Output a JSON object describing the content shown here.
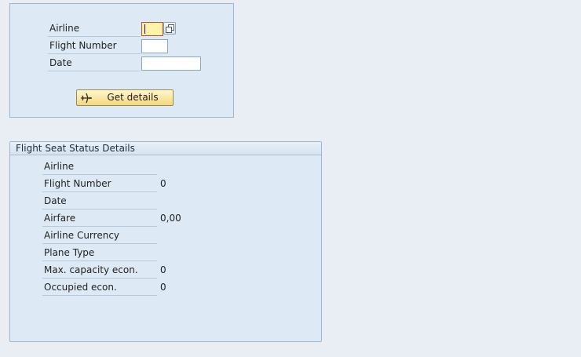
{
  "input_form": {
    "fields": [
      {
        "label": "Airline",
        "value": ""
      },
      {
        "label": "Flight Number",
        "value": ""
      },
      {
        "label": "Date",
        "value": ""
      }
    ],
    "button_label": "Get details",
    "button_icon": "airplane-icon",
    "help_icon": "value-help-icon"
  },
  "details": {
    "title": "Flight Seat Status Details",
    "rows": [
      {
        "label": "Airline",
        "value": ""
      },
      {
        "label": "Flight Number",
        "value": "0"
      },
      {
        "label": "Date",
        "value": ""
      },
      {
        "label": "Airfare",
        "value": "0,00"
      },
      {
        "label": "Airline Currency",
        "value": ""
      },
      {
        "label": "Plane Type",
        "value": ""
      },
      {
        "label": "Max. capacity econ.",
        "value": "0"
      },
      {
        "label": "Occupied econ.",
        "value": "0"
      }
    ]
  },
  "colors": {
    "background": "#e9eef5",
    "panel": "#dde9f4",
    "focus_field": "#fff3a7",
    "button": "#f6d87c"
  }
}
